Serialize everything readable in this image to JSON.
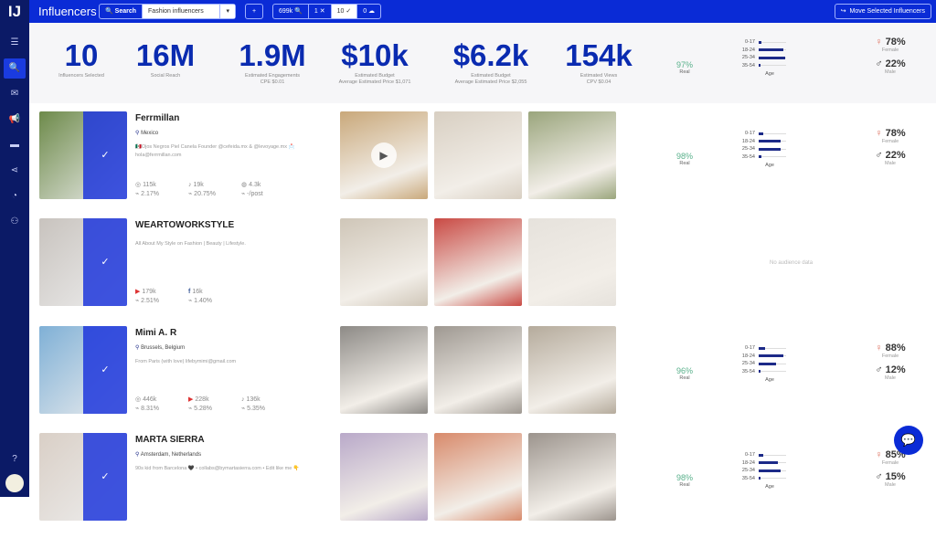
{
  "app": {
    "logo": "IJ",
    "title": "Influencers",
    "colors": {
      "primary": "#0a2bd6",
      "sidebar": "#0b1a66",
      "real": "#58b08a"
    }
  },
  "sidebar": {
    "items": [
      {
        "icon": "list-icon",
        "glyph": "☰"
      },
      {
        "icon": "search-icon",
        "glyph": "🔍",
        "active": true
      },
      {
        "icon": "inbox-icon",
        "glyph": "✉"
      },
      {
        "icon": "megaphone-icon",
        "glyph": "📢"
      },
      {
        "icon": "cards-icon",
        "glyph": "▬"
      },
      {
        "icon": "share-icon",
        "glyph": "⋖"
      },
      {
        "icon": "pie-chart-icon",
        "glyph": "◔"
      },
      {
        "icon": "users-icon",
        "glyph": "⚇"
      }
    ],
    "help_glyph": "?"
  },
  "toolbar": {
    "search_label": "Search",
    "search_value": "Fashion influencers",
    "dropdown": "▾",
    "add": "+",
    "count_found": "699k",
    "count_excluded": "1",
    "count_selected": "10",
    "count_saved": "0",
    "move_label": "Move Selected Influencers"
  },
  "summary": {
    "stats": [
      {
        "value": "10",
        "label": "Influencers Selected",
        "sub": ""
      },
      {
        "value": "16M",
        "label": "Social Reach",
        "sub": ""
      },
      {
        "value": "1.9M",
        "label": "Estimated Engagements",
        "sub": "CPE $0.01"
      },
      {
        "value": "$10k",
        "label": "Estimated Budget",
        "sub": "Average Estimated Price $1,071"
      },
      {
        "value": "$6.2k",
        "label": "Estimated Budget",
        "sub": "Average Estimated Price $2,055"
      },
      {
        "value": "154k",
        "label": "Estimated Views",
        "sub": "CPV $0.04"
      }
    ],
    "real": "97%",
    "real_label": "Real",
    "age": {
      "title": "Age",
      "groups": [
        {
          "label": "0-17",
          "value": 5
        },
        {
          "label": "18-24",
          "value": 45
        },
        {
          "label": "25-34",
          "value": 48
        },
        {
          "label": "35-54",
          "value": 4
        }
      ]
    },
    "female": "78%",
    "female_label": "Female",
    "male": "22%",
    "male_label": "Male"
  },
  "influencers": [
    {
      "name": "Ferrmillan",
      "location": "Mexico",
      "bio": "🇲🇽Ojos Negros Piel Canela Founder @cefeida.mx & @levoyage.mx 📩hola@ferrmillan.com",
      "metrics": [
        {
          "icon": "instagram-icon",
          "glyph": "◎",
          "followers": "115k",
          "rate": "2.17%"
        },
        {
          "icon": "tiktok-icon",
          "glyph": "♪",
          "followers": "19k",
          "rate": "20.75%"
        },
        {
          "icon": "web-icon",
          "glyph": "◍",
          "followers": "4.3k",
          "rate": "-/post"
        }
      ],
      "posts": [
        "#c9a87a",
        "#d8cfc2",
        "#9aa57c"
      ],
      "real": "98%",
      "age": [
        8,
        40,
        40,
        5
      ],
      "female": "78%",
      "male": "22%",
      "avatar": "#6d8a4a"
    },
    {
      "name": "WEARTOWORKSTYLE",
      "location": "",
      "bio": "All About My Style on Fashion | Beauty | Lifestyle.",
      "metrics": [
        {
          "icon": "youtube-icon",
          "glyph": "▶",
          "followers": "179k",
          "rate": "2.51%"
        },
        {
          "icon": "facebook-icon",
          "glyph": "f",
          "followers": "16k",
          "rate": "1.40%"
        }
      ],
      "posts": [
        "#cfc6b8",
        "#c94a44",
        "#e6e2dc"
      ],
      "no_audience": "No audience data",
      "avatar": "#c8c3be"
    },
    {
      "name": "Mimi A. R",
      "location": "Brussels, Belgium",
      "bio": "From Paris (with love) lifebymimi@gmail.com",
      "metrics": [
        {
          "icon": "instagram-icon",
          "glyph": "◎",
          "followers": "446k",
          "rate": "8.31%"
        },
        {
          "icon": "youtube-icon",
          "glyph": "▶",
          "followers": "228k",
          "rate": "5.28%"
        },
        {
          "icon": "tiktok-icon",
          "glyph": "♪",
          "followers": "136k",
          "rate": "5.35%"
        }
      ],
      "posts": [
        "#8d8a86",
        "#9e9891",
        "#b5ab9c"
      ],
      "real": "96%",
      "age": [
        12,
        45,
        32,
        3
      ],
      "female": "88%",
      "male": "12%",
      "avatar": "#7fb0d6"
    },
    {
      "name": "MARTA SIERRA",
      "location": "Amsterdam, Netherlands",
      "bio": "90s kid from Barcelona 🖤 • collabs@bymartasierra.com • Edit like me 👇",
      "metrics": [],
      "posts": [
        "#b9a9c9",
        "#d88a6b",
        "#9c948d"
      ],
      "real": "98%",
      "age": [
        8,
        35,
        40,
        4
      ],
      "female": "85%",
      "male": "15%",
      "avatar": "#d9cfc6"
    }
  ],
  "chat_glyph": "💬"
}
